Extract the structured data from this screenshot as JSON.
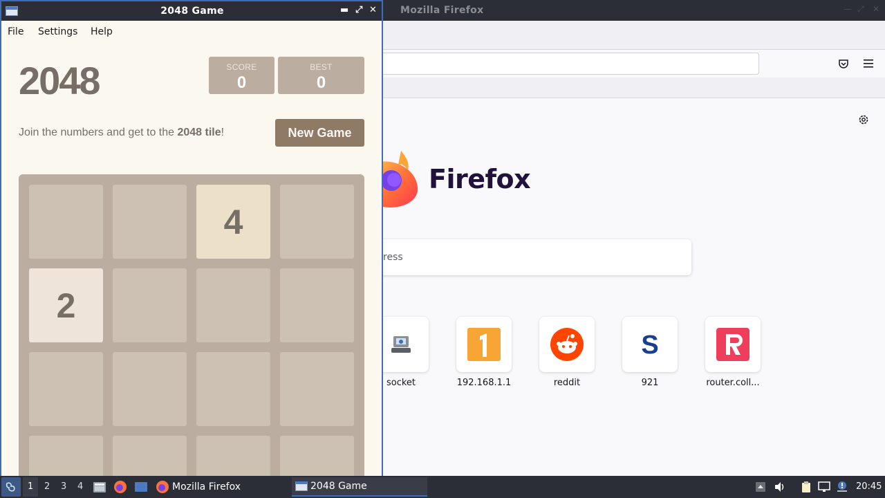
{
  "firefox": {
    "window_title": "Mozilla Firefox",
    "search_placeholder": "ress",
    "wordmark": "Firefox",
    "top_sites": [
      {
        "label": "socket",
        "icon": "socket-favicon"
      },
      {
        "label": "192.168.1.1",
        "icon": "number-one-favicon"
      },
      {
        "label": "reddit",
        "icon": "reddit-favicon"
      },
      {
        "label": "921",
        "icon": "s-favicon"
      },
      {
        "label": "router.coll...",
        "icon": "r-favicon"
      }
    ]
  },
  "game_window": {
    "title": "2048 Game",
    "menu": {
      "file": "File",
      "settings": "Settings",
      "help": "Help"
    },
    "heading": "2048",
    "score": {
      "label": "SCORE",
      "value": "0"
    },
    "best": {
      "label": "BEST",
      "value": "0"
    },
    "intro_prefix": "Join the numbers and get to the ",
    "intro_bold": "2048 tile",
    "intro_suffix": "!",
    "new_game_label": "New Game",
    "board": [
      [
        "",
        "",
        "4",
        ""
      ],
      [
        "2",
        "",
        "",
        ""
      ],
      [
        "",
        "",
        "",
        ""
      ],
      [
        "",
        "",
        "",
        ""
      ]
    ]
  },
  "taskbar": {
    "workspaces": [
      "1",
      "2",
      "3",
      "4"
    ],
    "active_workspace": "1",
    "tasks": [
      {
        "label": "Mozilla Firefox",
        "icon": "firefox-icon"
      },
      {
        "label": "2048 Game",
        "icon": "window-icon"
      }
    ],
    "clock": "20:45"
  },
  "colors": {
    "game_bg": "#fbf8ef",
    "board_bg": "#bbada0",
    "empty_cell": "#cdc1b4",
    "tile_2": "#eee4da",
    "tile_4": "#ede0c8",
    "tile_text": "#776e65",
    "button": "#8f7a66",
    "titlebar": "#2b2e37",
    "active_border": "#3c6dbd"
  }
}
